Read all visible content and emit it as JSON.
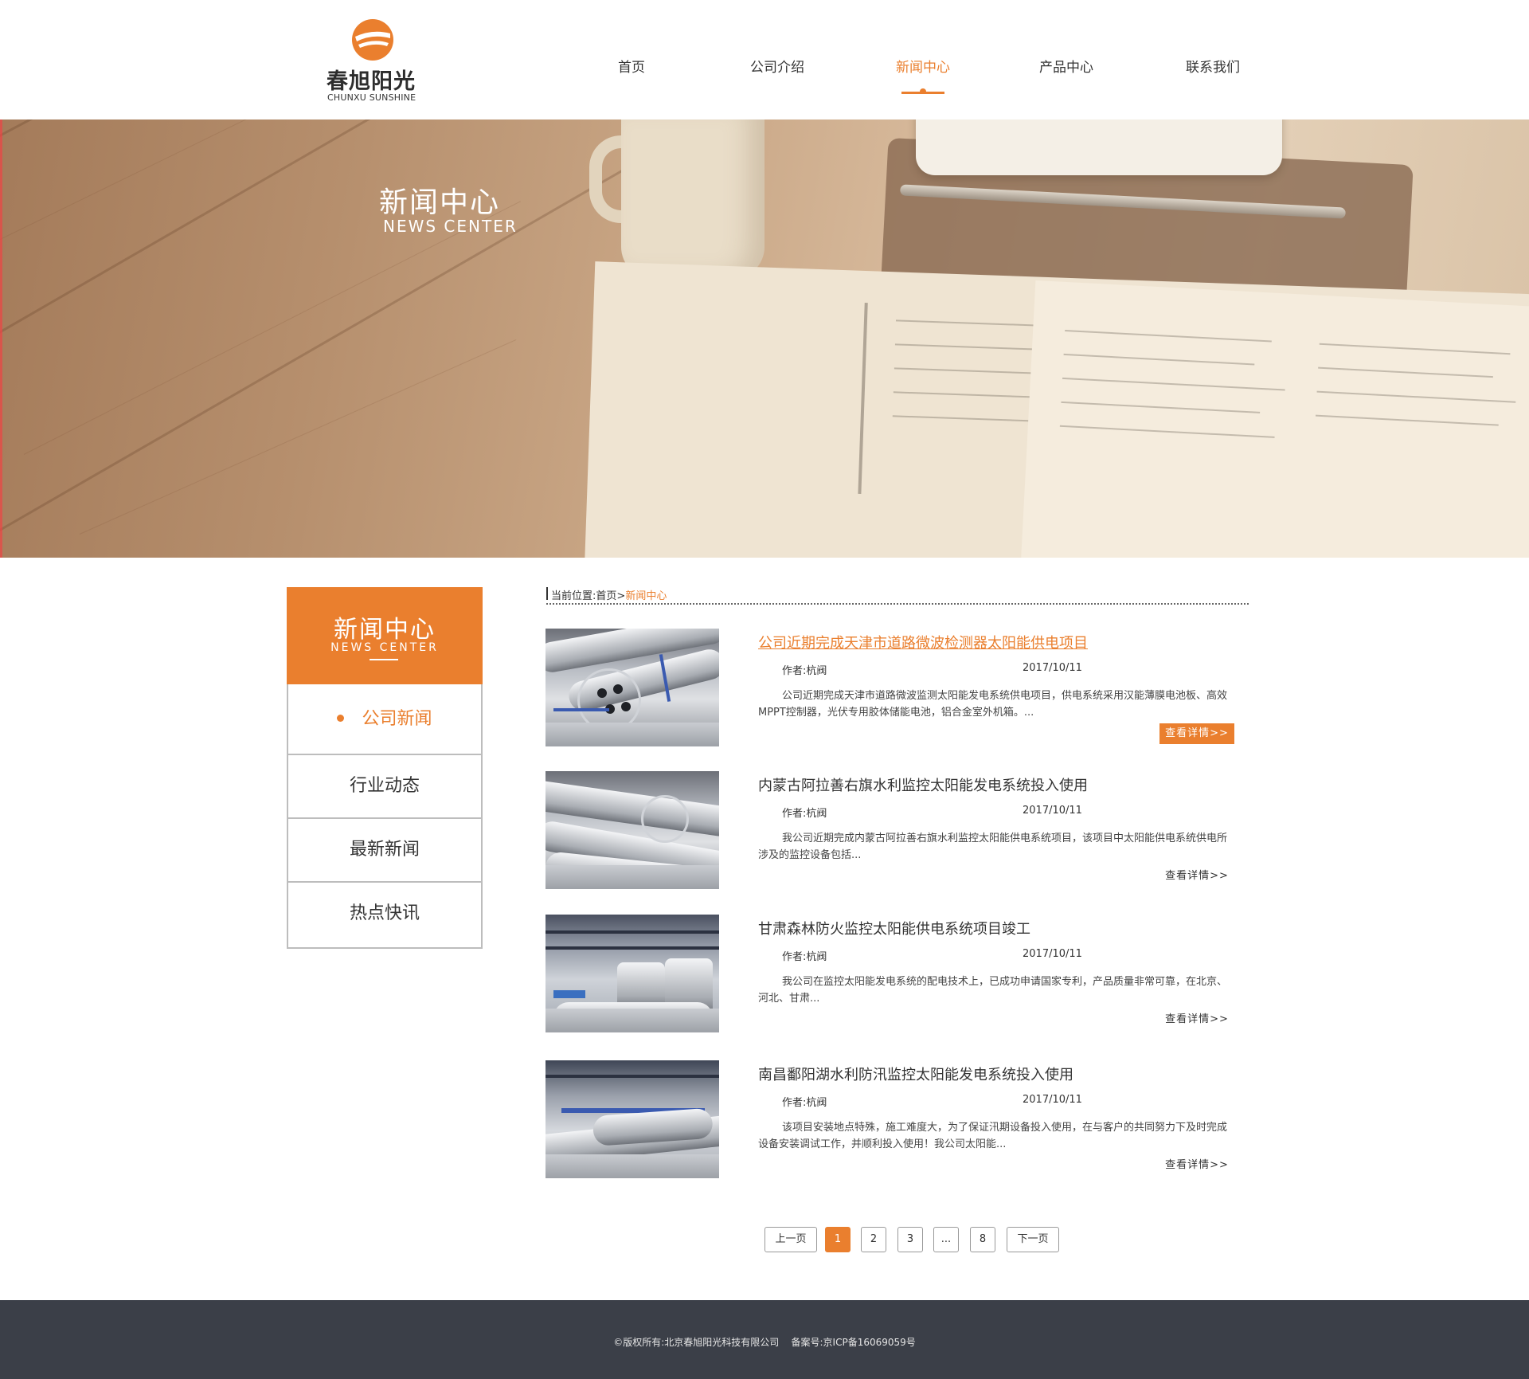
{
  "brand": {
    "name_cn": "春旭阳光",
    "name_en": "CHUNXU SUNSHINE",
    "accent_color": "#ea7f2e"
  },
  "nav": {
    "items": [
      {
        "label": "首页"
      },
      {
        "label": "公司介绍"
      },
      {
        "label": "新闻中心",
        "active": true
      },
      {
        "label": "产品中心"
      },
      {
        "label": "联系我们"
      }
    ]
  },
  "banner": {
    "title": "新闻中心",
    "subtitle": "NEWS CENTER"
  },
  "sidebar": {
    "title": "新闻中心",
    "subtitle": "NEWS CENTER",
    "items": [
      {
        "label": "公司新闻",
        "active": true
      },
      {
        "label": "行业动态"
      },
      {
        "label": "最新新闻"
      },
      {
        "label": "热点快讯"
      }
    ]
  },
  "breadcrumb": {
    "prefix": "当前位置:",
    "home": "首页",
    "separator": ">",
    "current": "新闻中心"
  },
  "news": [
    {
      "title": "公司近期完成天津市道路微波检测器太阳能供电项目",
      "author": "作者:杭阀",
      "date": "2017/10/11",
      "desc": "公司近期完成天津市道路微波监测太阳能发电系统供电项目，供电系统采用汉能薄膜电池板、高效MPPT控制器，光伏专用胶体储能电池，铝合金室外机箱。...",
      "more": "查看详情>>",
      "active": true
    },
    {
      "title": "内蒙古阿拉善右旗水利监控太阳能发电系统投入使用",
      "author": "作者:杭阀",
      "date": "2017/10/11",
      "desc": "我公司近期完成内蒙古阿拉善右旗水利监控太阳能供电系统项目，该项目中太阳能供电系统供电所涉及的监控设备包括...",
      "more": "查看详情>>"
    },
    {
      "title": "甘肃森林防火监控太阳能供电系统项目竣工",
      "author": "作者:杭阀",
      "date": "2017/10/11",
      "desc": "我公司在监控太阳能发电系统的配电技术上，已成功申请国家专利，产品质量非常可靠，在北京、河北、甘肃...",
      "more": "查看详情>>"
    },
    {
      "title": "南昌鄱阳湖水利防汛监控太阳能发电系统投入使用",
      "author": "作者:杭阀",
      "date": "2017/10/11",
      "desc": "该项目安装地点特殊，施工难度大，为了保证汛期设备投入使用，在与客户的共同努力下及时完成设备安装调试工作，并顺利投入使用！我公司太阳能...",
      "more": "查看详情>>"
    }
  ],
  "pagination": {
    "prev": "上一页",
    "pages": [
      "1",
      "2",
      "3",
      "...",
      "8"
    ],
    "current": "1",
    "next": "下一页"
  },
  "footer": {
    "text": "©版权所有:北京春旭阳光科技有限公司    备案号:京ICP备16069059号"
  }
}
